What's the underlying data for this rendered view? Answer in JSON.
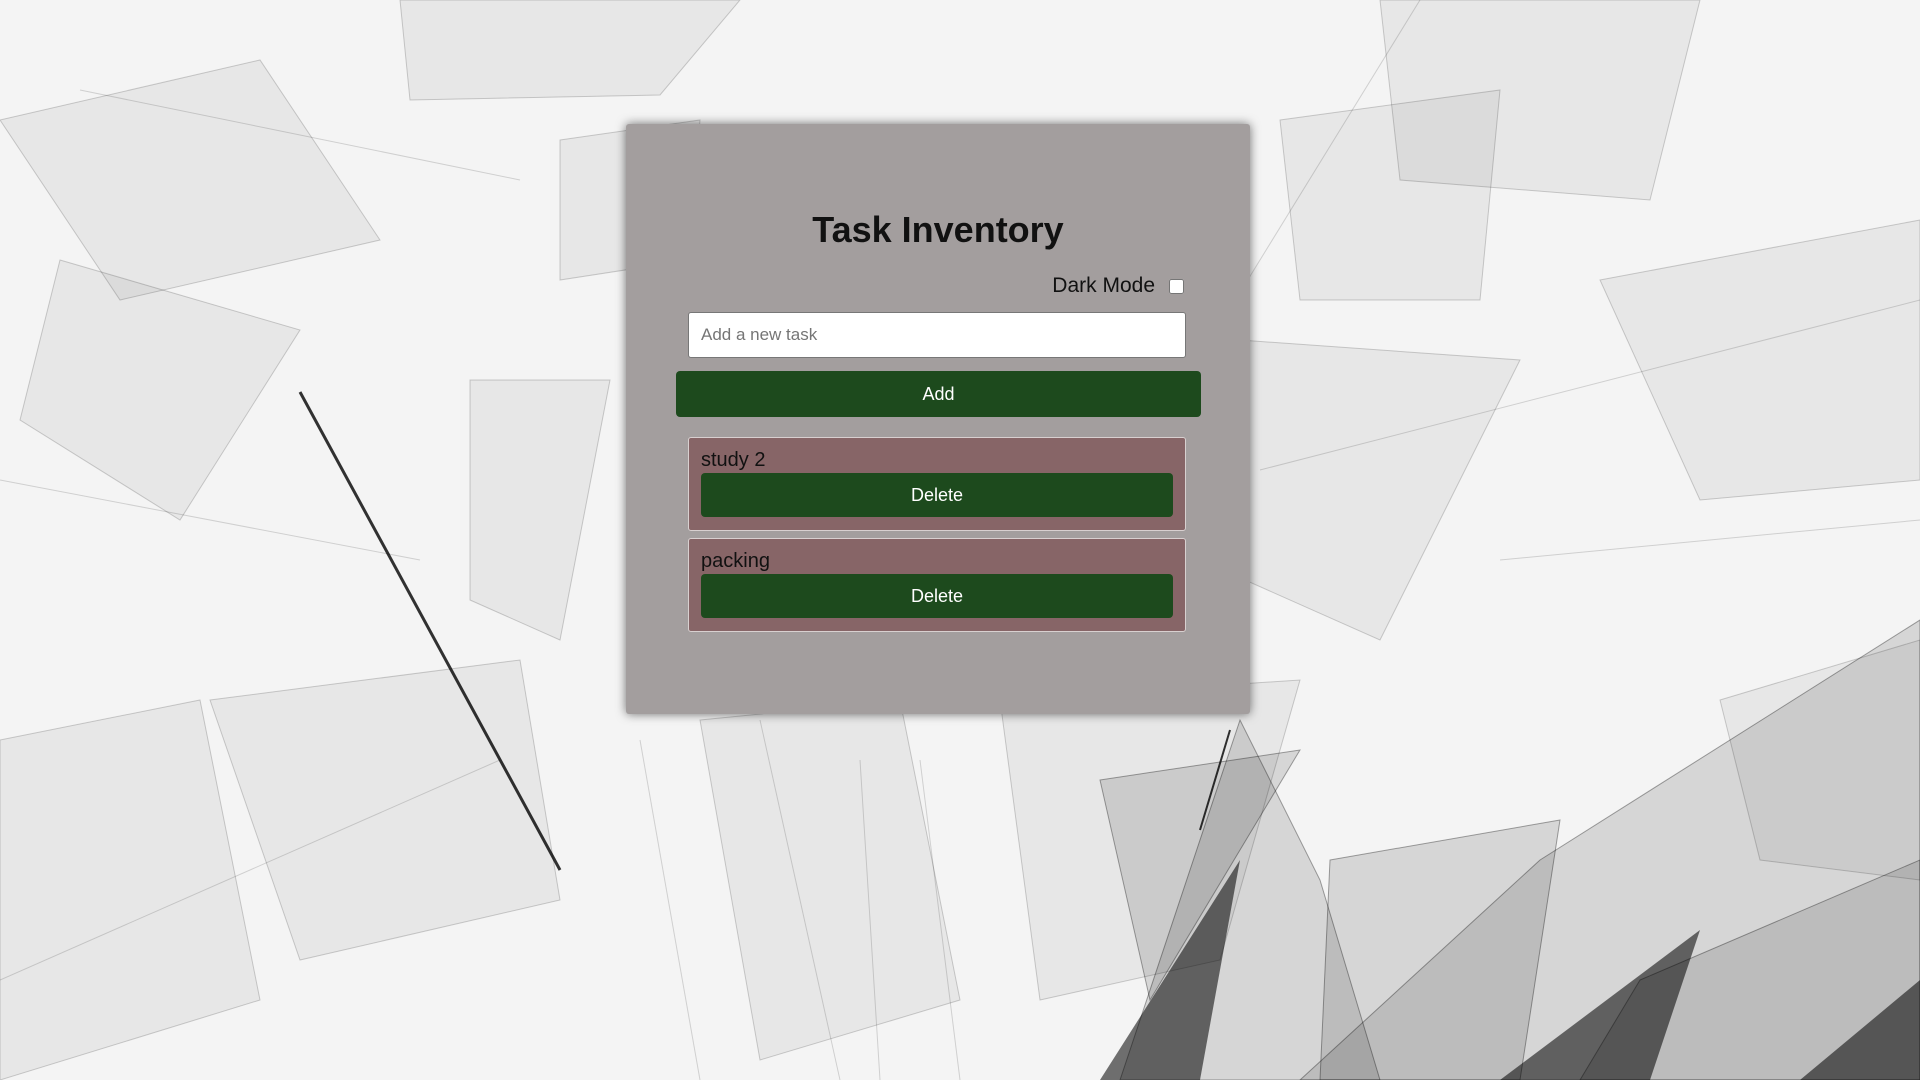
{
  "app": {
    "title": "Task Inventory"
  },
  "dark_mode": {
    "label": "Dark Mode",
    "checked": false
  },
  "new_task": {
    "value": "",
    "placeholder": "Add a new task"
  },
  "add_button": {
    "label": "Add"
  },
  "tasks": [
    {
      "text": "study 2",
      "delete_label": "Delete"
    },
    {
      "text": "packing",
      "delete_label": "Delete"
    }
  ],
  "colors": {
    "card_bg": "#a39e9e",
    "button_green": "#1d4a1d",
    "task_bg": "#876567",
    "text": "#111111"
  }
}
